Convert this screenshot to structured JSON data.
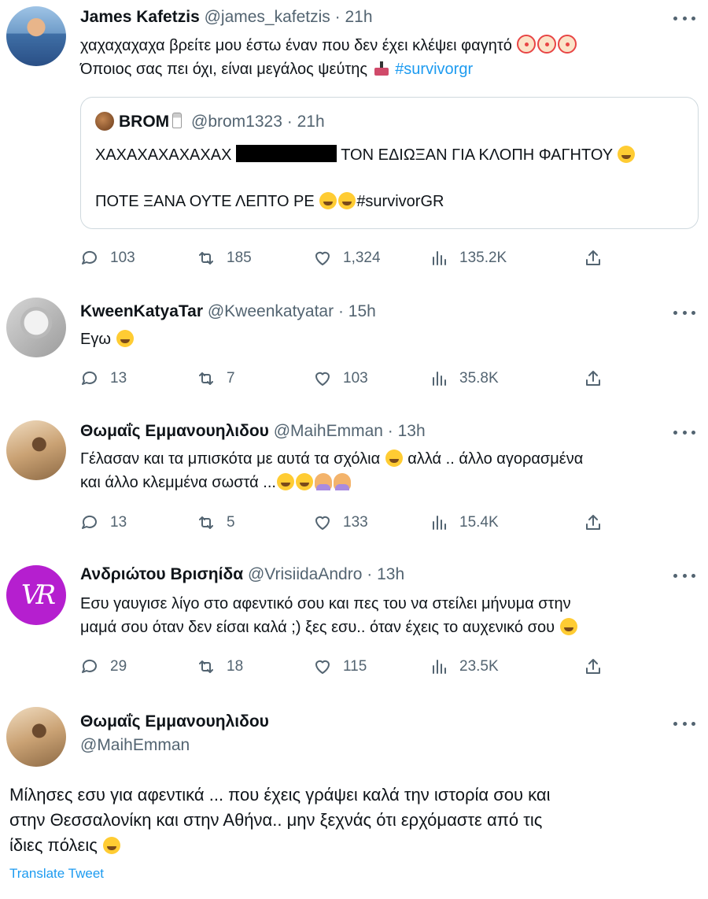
{
  "tweets": [
    {
      "name": "James Kafetzis",
      "handle": "@james_kafetzis",
      "time": "21h",
      "line1": "χαχαχαχαχα βρείτε μου έστω έναν που δεν έχει κλέψει φαγητό",
      "line2": "Όποιος σας πει όχι, είναι μεγάλος ψεύτης",
      "hashtag": "#survivorgr",
      "quote": {
        "name": "BROM",
        "handle": "@brom1323",
        "time": "21h",
        "line1_start": "ΧΑΧΑΧΑΧΑΧΑΧΑΧ",
        "line1_end": "ΤΟΝ ΕΔΙΩΞΑΝ ΓΙΑ ΚΛΟΠΗ ΦΑΓΗΤΟΥ",
        "line2": "ΠΟΤΕ ΞΑΝΑ ΟΥΤΕ ΛΕΠΤΟ ΡΕ",
        "hashtag": "#survivorGR"
      },
      "replies": "103",
      "retweets": "185",
      "likes": "1,324",
      "views": "135.2K"
    },
    {
      "name": "KweenKatyaTar",
      "handle": "@Kweenkatyatar",
      "time": "15h",
      "text": "Εγω",
      "replies": "13",
      "retweets": "7",
      "likes": "103",
      "views": "35.8K"
    },
    {
      "name": "Θωμαΐς Εμμανουηλιδου",
      "handle": "@MaihEmman",
      "time": "13h",
      "line1": "Γέλασαν και τα μπισκότα με αυτά τα σχόλια",
      "line1_end": "αλλά .. άλλο αγορασμένα",
      "line2": "και άλλο κλεμμένα σωστά ...",
      "replies": "13",
      "retweets": "5",
      "likes": "133",
      "views": "15.4K"
    },
    {
      "name": "Ανδριώτου Βρισηίδα",
      "handle": "@VrisiidaAndro",
      "time": "13h",
      "avatar_text": "VR",
      "line1": "Εσυ γαυγισε λίγο στο αφεντικό σου και πες του να στείλει μήνυμα στην",
      "line2": "μαμά σου όταν δεν είσαι καλά  ;) ξες εσυ.. όταν έχεις το αυχενικό σου",
      "replies": "29",
      "retweets": "18",
      "likes": "115",
      "views": "23.5K"
    }
  ],
  "main": {
    "name": "Θωμαΐς Εμμανουηλιδου",
    "handle": "@MaihEmman",
    "line1": "Μίλησες εσυ για αφεντικά ... που έχεις γράψει καλά την ιστορία σου και",
    "line2": "στην Θεσσαλονίκη και στην Αθήνα.. μην ξεχνάς ότι ερχόμαστε από τις",
    "line3": "ίδιες πόλεις",
    "translate": "Translate Tweet"
  },
  "colors": {
    "link": "#1d9bf0",
    "muted": "#536471",
    "border": "#cfd9de",
    "vr_avatar": "#b51fcf"
  }
}
